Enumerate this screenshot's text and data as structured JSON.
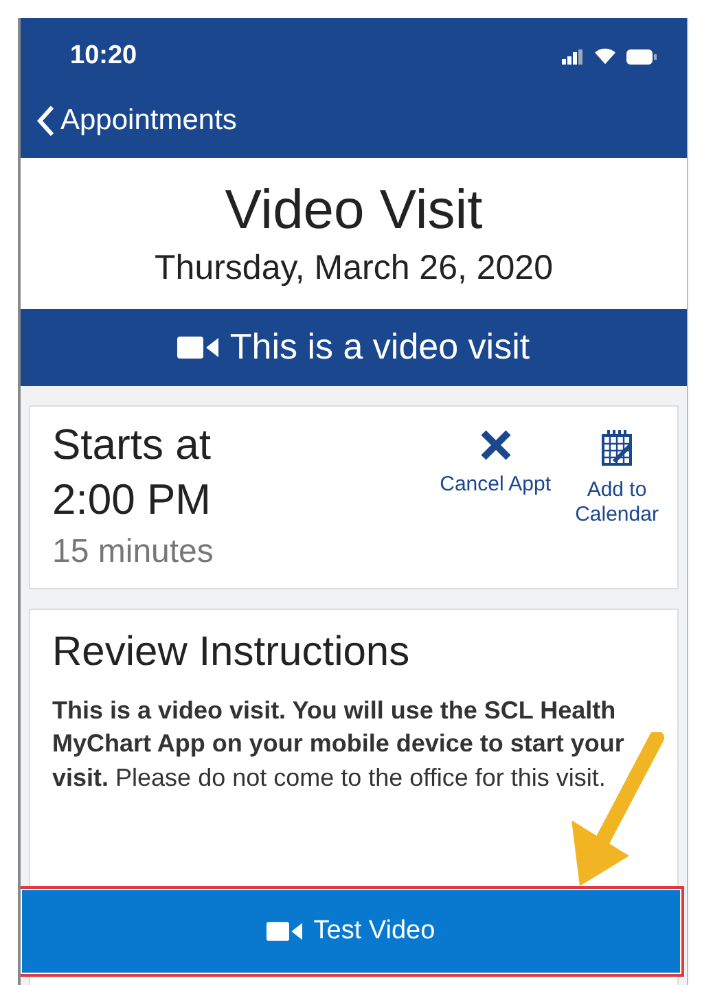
{
  "status_bar": {
    "time": "10:20"
  },
  "nav": {
    "back_label": "Appointments"
  },
  "header": {
    "title": "Video Visit",
    "date": "Thursday, March 26, 2020"
  },
  "banner": {
    "text": "This is a video visit"
  },
  "time_card": {
    "label": "Starts at",
    "time": "2:00 PM",
    "duration": "15 minutes",
    "actions": [
      {
        "kind": "cancel",
        "label": "Cancel Appt"
      },
      {
        "kind": "calendar",
        "label": "Add to Calendar"
      }
    ]
  },
  "instructions": {
    "title": "Review Instructions",
    "text": "**This is a video visit. You will use the SCL Health MyChart App on your mobile device to start your visit.**  Please do not come to the office for this visit."
  },
  "test_button": {
    "label": "Test Video",
    "highlighted": true
  }
}
